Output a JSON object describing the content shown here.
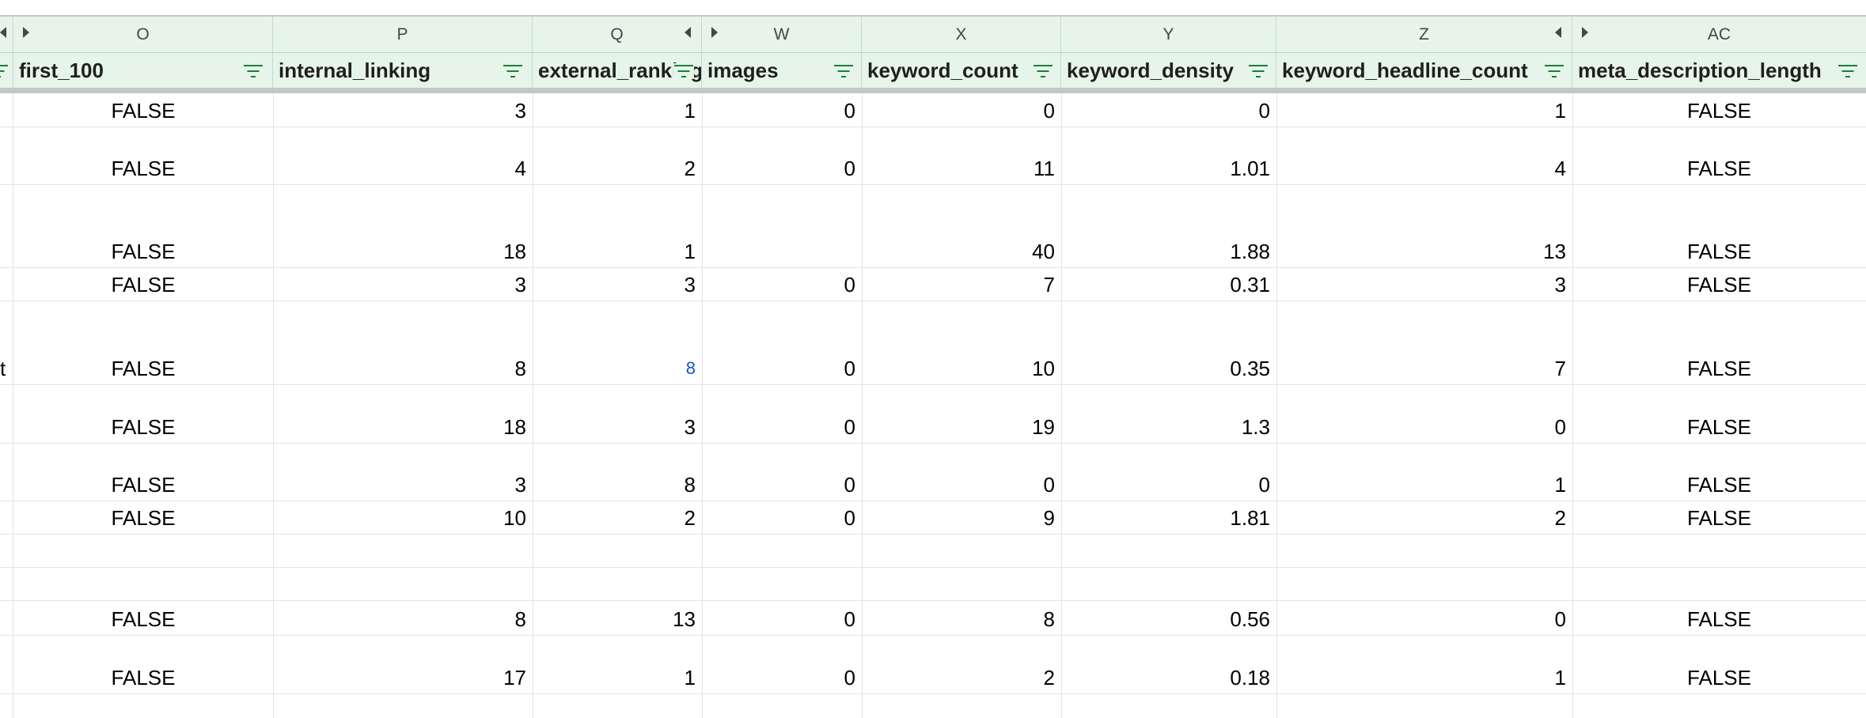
{
  "columns": [
    {
      "letter": "O",
      "field": "first_100"
    },
    {
      "letter": "P",
      "field": "internal_linking"
    },
    {
      "letter": "Q",
      "field": "external_ranking"
    },
    {
      "letter": "W",
      "field": "images"
    },
    {
      "letter": "X",
      "field": "keyword_count"
    },
    {
      "letter": "Y",
      "field": "keyword_density"
    },
    {
      "letter": "Z",
      "field": "keyword_headline_count"
    },
    {
      "letter": "AC",
      "field": "meta_description_length"
    }
  ],
  "left_edge_text": "t",
  "rows": [
    [
      "FALSE",
      "3",
      "1",
      "0",
      "0",
      "0",
      "1",
      "FALSE"
    ],
    [
      "FALSE",
      "4",
      "2",
      "0",
      "11",
      "1.01",
      "4",
      "FALSE"
    ],
    [
      "FALSE",
      "18",
      "1",
      "",
      "40",
      "1.88",
      "13",
      "FALSE"
    ],
    [
      "FALSE",
      "3",
      "3",
      "0",
      "7",
      "0.31",
      "3",
      "FALSE"
    ],
    [
      "FALSE",
      "8",
      "8",
      "0",
      "10",
      "0.35",
      "7",
      "FALSE"
    ],
    [
      "FALSE",
      "18",
      "3",
      "0",
      "19",
      "1.3",
      "0",
      "FALSE"
    ],
    [
      "FALSE",
      "3",
      "8",
      "0",
      "0",
      "0",
      "1",
      "FALSE"
    ],
    [
      "FALSE",
      "10",
      "2",
      "0",
      "9",
      "1.81",
      "2",
      "FALSE"
    ],
    [
      "",
      "",
      "",
      "",
      "",
      "",
      "",
      ""
    ],
    [
      "",
      "",
      "",
      "",
      "",
      "",
      "",
      ""
    ],
    [
      "FALSE",
      "8",
      "13",
      "0",
      "8",
      "0.56",
      "0",
      "FALSE"
    ],
    [
      "FALSE",
      "17",
      "1",
      "0",
      "2",
      "0.18",
      "1",
      "FALSE"
    ],
    [
      "",
      "",
      "",
      "",
      "",
      "",
      "",
      ""
    ]
  ],
  "colors": {
    "header_bg": "#e6f4ea",
    "filter_icon": "#188038",
    "link": "#1155cc",
    "gridline": "#e1e3e1"
  }
}
